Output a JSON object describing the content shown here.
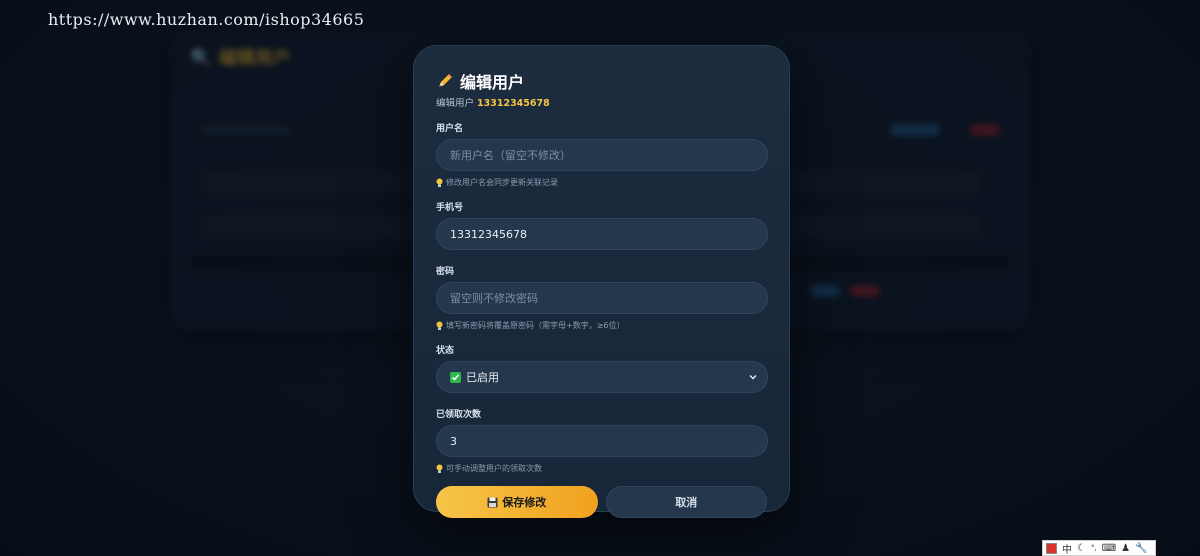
{
  "watermark": "https://www.huzhan.com/ishop34665",
  "modal": {
    "title": "编辑用户",
    "subtitle_prefix": "编辑用户",
    "subtitle_phone": "13312345678",
    "fields": {
      "username": {
        "label": "用户名",
        "value": "",
        "placeholder": "新用户名（留空不修改）",
        "hint": "修改用户名会同步更新关联记录"
      },
      "phone": {
        "label": "手机号",
        "value": "13312345678"
      },
      "password": {
        "label": "密码",
        "value": "",
        "placeholder": "留空则不修改密码",
        "hint": "填写新密码将覆盖原密码（需字母+数字，≥6位）"
      },
      "status": {
        "label": "状态",
        "selected": "已启用"
      },
      "claim_count": {
        "label": "已领取次数",
        "value": "3",
        "hint": "可手动调整用户的领取次数"
      }
    },
    "buttons": {
      "save": "保存修改",
      "cancel": "取消"
    }
  },
  "background": {
    "title": "编辑用户"
  },
  "tray": {
    "ime": "中"
  },
  "colors": {
    "accent": "#f5c542",
    "modal_bg": "#1c2c3f",
    "field_bg": "#24374d",
    "enabled_green": "#2db84b"
  },
  "icons": {
    "title": "pencil-icon",
    "hint": "bulb-icon",
    "status": "check-icon",
    "select": "chevron-down-icon",
    "save": "save-icon"
  }
}
